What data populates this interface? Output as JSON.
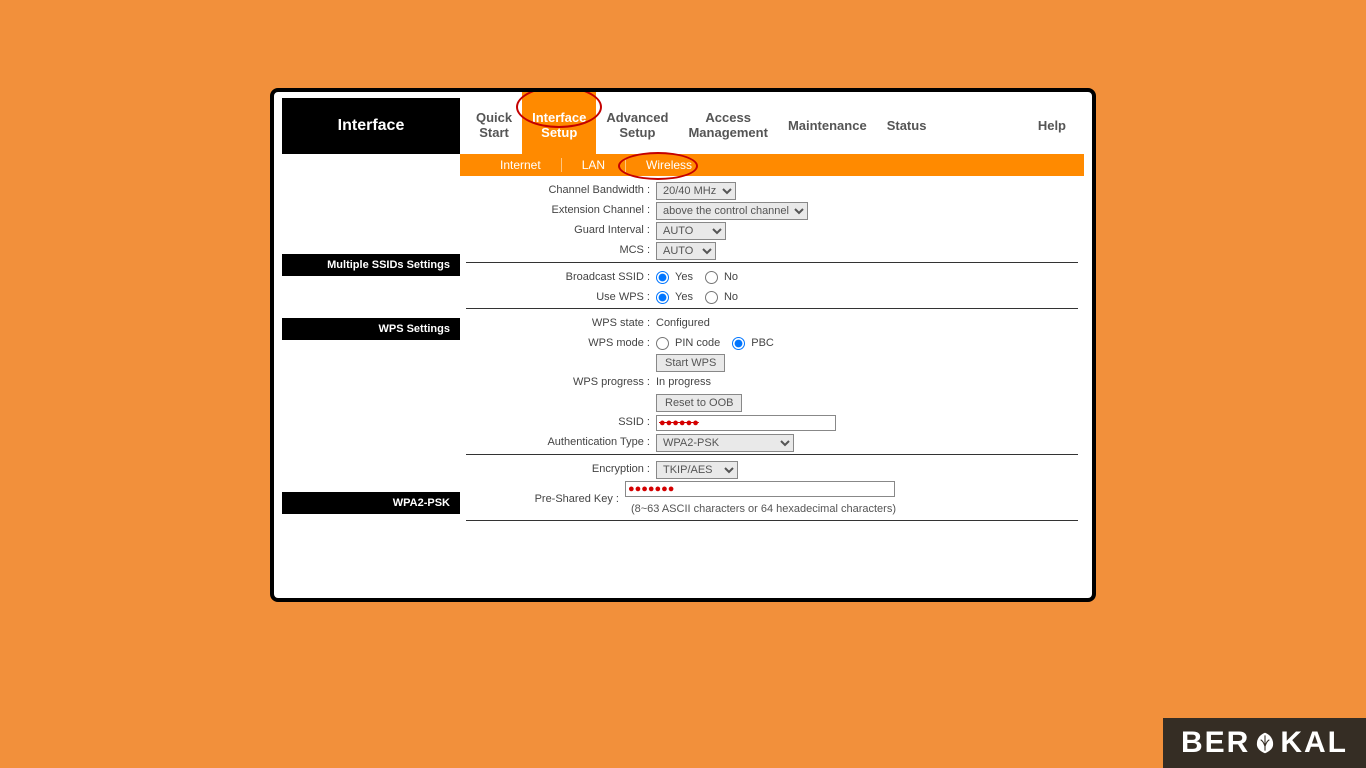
{
  "sidebar_title": "Interface",
  "tabs": {
    "quick_start": "Quick\nStart",
    "interface_setup": "Interface\nSetup",
    "advanced_setup": "Advanced\nSetup",
    "access_management": "Access\nManagement",
    "maintenance": "Maintenance",
    "status": "Status",
    "help": "Help"
  },
  "subtabs": {
    "internet": "Internet",
    "lan": "LAN",
    "wireless": "Wireless"
  },
  "sections": {
    "multiple_ssid": "Multiple SSIDs Settings",
    "wps": "WPS Settings",
    "wpa2": "WPA2-PSK"
  },
  "labels": {
    "channel_bandwidth": "Channel Bandwidth :",
    "extension_channel": "Extension Channel :",
    "guard_interval": "Guard Interval :",
    "mcs": "MCS :",
    "broadcast_ssid": "Broadcast SSID :",
    "use_wps": "Use WPS :",
    "wps_state": "WPS state :",
    "wps_mode": "WPS mode :",
    "wps_progress": "WPS progress :",
    "ssid": "SSID :",
    "auth_type": "Authentication Type :",
    "encryption": "Encryption :",
    "psk": "Pre-Shared Key :"
  },
  "values": {
    "channel_bandwidth": "20/40 MHz",
    "extension_channel": "above the control channel",
    "guard_interval": "AUTO",
    "mcs": "AUTO",
    "yes": "Yes",
    "no": "No",
    "wps_state": "Configured",
    "pin_code": "PIN code",
    "pbc": "PBC",
    "start_wps": "Start WPS",
    "wps_progress": "In progress",
    "reset_oob": "Reset to OOB",
    "ssid": "●●●●●●",
    "auth_type": "WPA2-PSK",
    "encryption": "TKIP/AES",
    "psk": "●●●●●●●",
    "psk_hint": "(8~63 ASCII characters or 64 hexadecimal characters)"
  },
  "watermark": {
    "pre": "BER",
    "post": "KAL"
  }
}
